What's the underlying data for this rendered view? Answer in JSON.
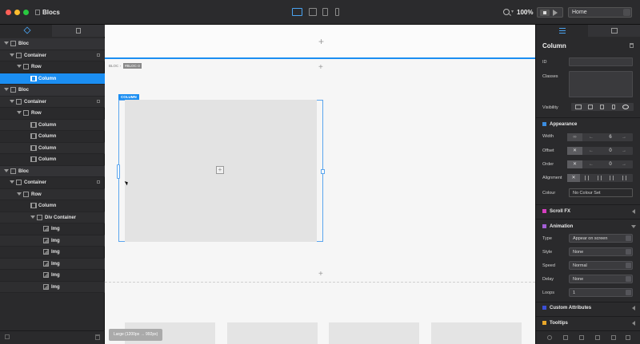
{
  "app": {
    "title": "Blocs"
  },
  "toolbar": {
    "zoom": "100%",
    "page_select": "Home",
    "devices": [
      "desktop",
      "laptop",
      "tablet",
      "phone"
    ],
    "active_device": "desktop"
  },
  "left_panel": {
    "tabs": [
      {
        "icon": "layers-icon",
        "active": true
      },
      {
        "icon": "pages-icon",
        "active": false
      }
    ],
    "tree": [
      {
        "label": "Bloc",
        "type": "bloc",
        "depth": 0,
        "expanded": true,
        "selected": false,
        "locked": false
      },
      {
        "label": "Container",
        "type": "container",
        "depth": 1,
        "expanded": true,
        "selected": false,
        "locked": true
      },
      {
        "label": "Row",
        "type": "row",
        "depth": 2,
        "expanded": true,
        "selected": false,
        "locked": false
      },
      {
        "label": "Column",
        "type": "column",
        "depth": 3,
        "expanded": false,
        "selected": true,
        "locked": false
      },
      {
        "label": "Bloc",
        "type": "bloc",
        "depth": 0,
        "expanded": true,
        "selected": false,
        "locked": false
      },
      {
        "label": "Container",
        "type": "container",
        "depth": 1,
        "expanded": true,
        "selected": false,
        "locked": true
      },
      {
        "label": "Row",
        "type": "row",
        "depth": 2,
        "expanded": true,
        "selected": false,
        "locked": false
      },
      {
        "label": "Column",
        "type": "column",
        "depth": 3,
        "expanded": false,
        "selected": false,
        "locked": false
      },
      {
        "label": "Column",
        "type": "column",
        "depth": 3,
        "expanded": false,
        "selected": false,
        "locked": false
      },
      {
        "label": "Column",
        "type": "column",
        "depth": 3,
        "expanded": false,
        "selected": false,
        "locked": false
      },
      {
        "label": "Column",
        "type": "column",
        "depth": 3,
        "expanded": false,
        "selected": false,
        "locked": false
      },
      {
        "label": "Bloc",
        "type": "bloc",
        "depth": 0,
        "expanded": true,
        "selected": false,
        "locked": false
      },
      {
        "label": "Container",
        "type": "container",
        "depth": 1,
        "expanded": true,
        "selected": false,
        "locked": true
      },
      {
        "label": "Row",
        "type": "row",
        "depth": 2,
        "expanded": true,
        "selected": false,
        "locked": false
      },
      {
        "label": "Column",
        "type": "column",
        "depth": 3,
        "expanded": true,
        "selected": false,
        "locked": false
      },
      {
        "label": "Div Container",
        "type": "div",
        "depth": 4,
        "expanded": true,
        "selected": false,
        "locked": false
      },
      {
        "label": "Img",
        "type": "img",
        "depth": 5,
        "expanded": false,
        "selected": false,
        "locked": false
      },
      {
        "label": "Img",
        "type": "img",
        "depth": 5,
        "expanded": false,
        "selected": false,
        "locked": false
      },
      {
        "label": "Img",
        "type": "img",
        "depth": 5,
        "expanded": false,
        "selected": false,
        "locked": false
      },
      {
        "label": "Img",
        "type": "img",
        "depth": 5,
        "expanded": false,
        "selected": false,
        "locked": false
      },
      {
        "label": "Img",
        "type": "img",
        "depth": 5,
        "expanded": false,
        "selected": false,
        "locked": false
      },
      {
        "label": "Img",
        "type": "img",
        "depth": 5,
        "expanded": false,
        "selected": false,
        "locked": false
      }
    ]
  },
  "canvas": {
    "breadcrumb_prefix": "BLOC ›",
    "breadcrumb_id": "#BLOC-3",
    "column_badge": "COLUMN",
    "add_symbol": "+",
    "breakpoint_label": "Large (1200px → 992px)"
  },
  "inspector": {
    "title": "Column",
    "fields": {
      "id_label": "ID",
      "id_value": "",
      "classes_label": "Classes",
      "visibility_label": "Visibility"
    },
    "appearance": {
      "section_label": "Appearance",
      "section_color": "#3b8de0",
      "width_label": "Width",
      "width_value": "6",
      "offset_label": "Offset",
      "offset_value": "0",
      "order_label": "Order",
      "order_value": "0",
      "alignment_label": "Alignment",
      "colour_label": "Colour",
      "colour_value": "No Colour Set"
    },
    "scroll_fx": {
      "label": "Scroll FX",
      "color": "#d63fbf"
    },
    "animation": {
      "label": "Animation",
      "color": "#a45fd6",
      "type_label": "Type",
      "type_value": "Appear on screen",
      "style_label": "Style",
      "style_value": "None",
      "speed_label": "Speed",
      "speed_value": "Normal",
      "delay_label": "Delay",
      "delay_value": "None",
      "loops_label": "Loops",
      "loops_value": "1"
    },
    "custom_attributes": {
      "label": "Custom Attributes",
      "color": "#3b4fd6"
    },
    "tooltips": {
      "label": "Tooltips",
      "color": "#e8a72a"
    }
  },
  "colors": {
    "accent": "#1b8ef2",
    "panel": "#2a2a2c",
    "canvas": "#f6f6f6"
  }
}
